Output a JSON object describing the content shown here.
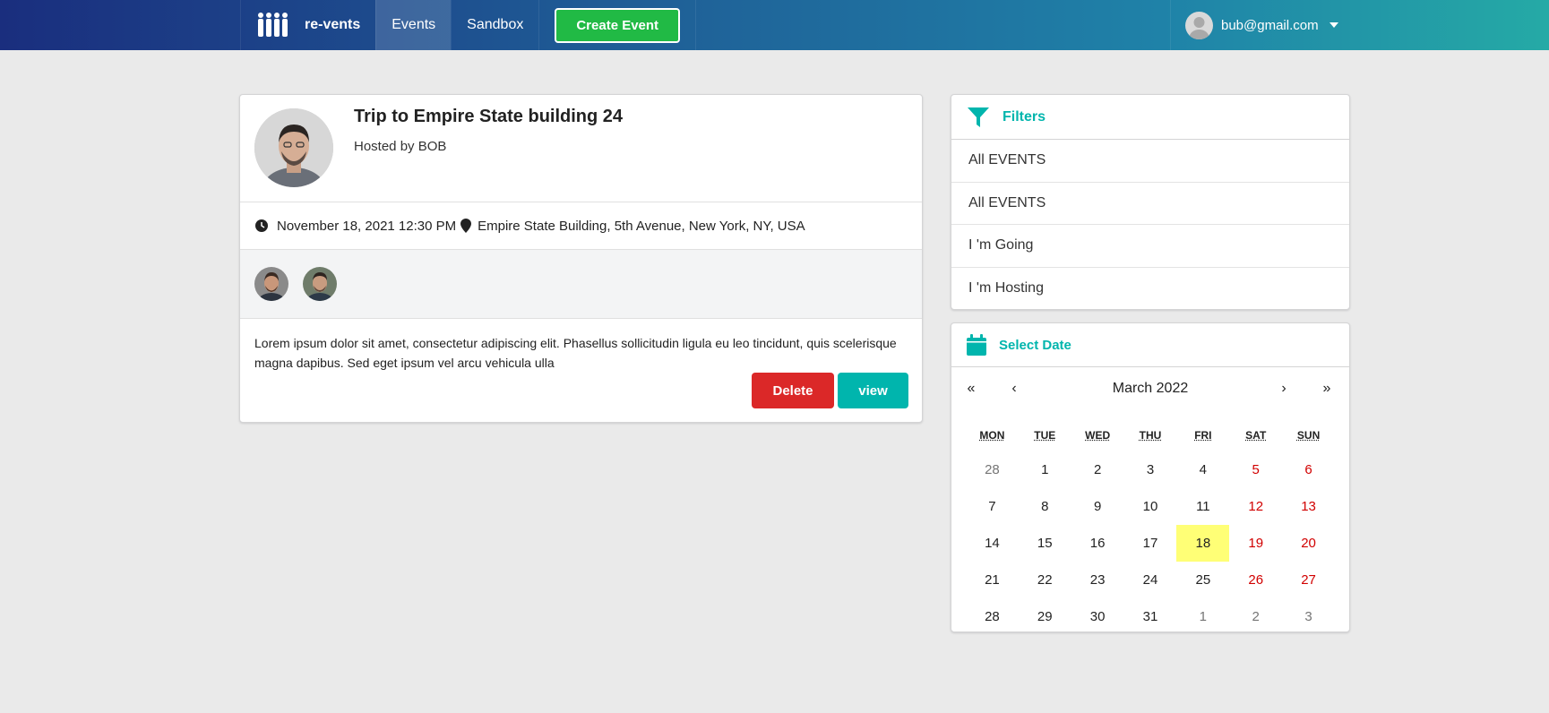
{
  "navbar": {
    "brand": "re-vents",
    "items": [
      {
        "label": "Events",
        "active": true
      },
      {
        "label": "Sandbox",
        "active": false
      }
    ],
    "create_button": "Create Event",
    "user_email": "bub@gmail.com",
    "gradient_colors": [
      "#1a2e7e",
      "#25aaa6"
    ]
  },
  "event": {
    "title": "Trip to Empire State building 24",
    "hosted_by": "Hosted by BOB",
    "datetime": "November 18, 2021 12:30 PM",
    "venue": "Empire State Building, 5th Avenue, New York, NY, USA",
    "description": "Lorem ipsum dolor sit amet, consectetur adipiscing elit. Phasellus sollicitudin ligula eu leo tincidunt, quis scelerisque magna dapibus. Sed eget ipsum vel arcu vehicula ulla",
    "delete_label": "Delete",
    "view_label": "view"
  },
  "filters": {
    "title": "Filters",
    "items": [
      "All EVENTS",
      "All EVENTS",
      "I 'm Going",
      "I 'm Hosting"
    ]
  },
  "calendar": {
    "title": "Select Date",
    "month_label": "March 2022",
    "nav": {
      "prev_year": "«",
      "prev_month": "‹",
      "next_month": "›",
      "next_year": "»"
    },
    "weekdays": [
      "MON",
      "TUE",
      "WED",
      "THU",
      "FRI",
      "SAT",
      "SUN"
    ],
    "days": [
      {
        "d": "28",
        "other": true
      },
      {
        "d": "1"
      },
      {
        "d": "2"
      },
      {
        "d": "3"
      },
      {
        "d": "4"
      },
      {
        "d": "5"
      },
      {
        "d": "6"
      },
      {
        "d": "7"
      },
      {
        "d": "8"
      },
      {
        "d": "9"
      },
      {
        "d": "10"
      },
      {
        "d": "11"
      },
      {
        "d": "12"
      },
      {
        "d": "13"
      },
      {
        "d": "14"
      },
      {
        "d": "15"
      },
      {
        "d": "16"
      },
      {
        "d": "17"
      },
      {
        "d": "18",
        "selected": true
      },
      {
        "d": "19"
      },
      {
        "d": "20"
      },
      {
        "d": "21"
      },
      {
        "d": "22"
      },
      {
        "d": "23"
      },
      {
        "d": "24"
      },
      {
        "d": "25"
      },
      {
        "d": "26"
      },
      {
        "d": "27"
      },
      {
        "d": "28"
      },
      {
        "d": "29"
      },
      {
        "d": "30"
      },
      {
        "d": "31"
      },
      {
        "d": "1",
        "other": true
      },
      {
        "d": "2",
        "other": true
      },
      {
        "d": "3",
        "other": true
      }
    ],
    "selected_color": "#ffff76",
    "weekend_color": "#d10000"
  }
}
